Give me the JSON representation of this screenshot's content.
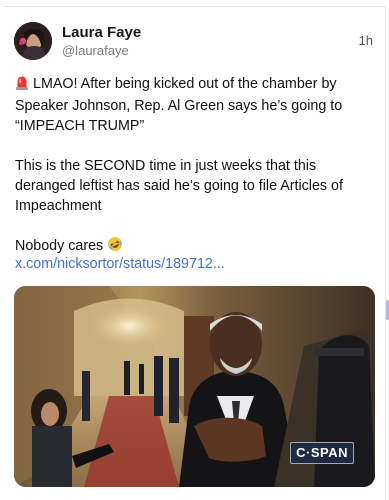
{
  "post": {
    "author_name": "Laura Faye",
    "author_handle": "@laurafaye",
    "timestamp": "1h",
    "paragraph_1": "LMAO! After being kicked out of the chamber by Speaker Johnson, Rep. Al Green says he’s going to “IMPEACH TRUMP”",
    "paragraph_2": "This is the SECOND time in just weeks that this deranged leftist has said he’s going to file Articles of Impeachment",
    "paragraph_3": "Nobody cares",
    "link_text": "x.com/nicksortor/status/189712...",
    "media_watermark": "C·SPAN"
  },
  "icons": {
    "siren": "rotating-light-emoji",
    "laughing": "rolling-on-floor-laughing-emoji"
  },
  "colors": {
    "link": "#3e74c9",
    "text": "#111111",
    "muted": "#7a7a7a"
  }
}
